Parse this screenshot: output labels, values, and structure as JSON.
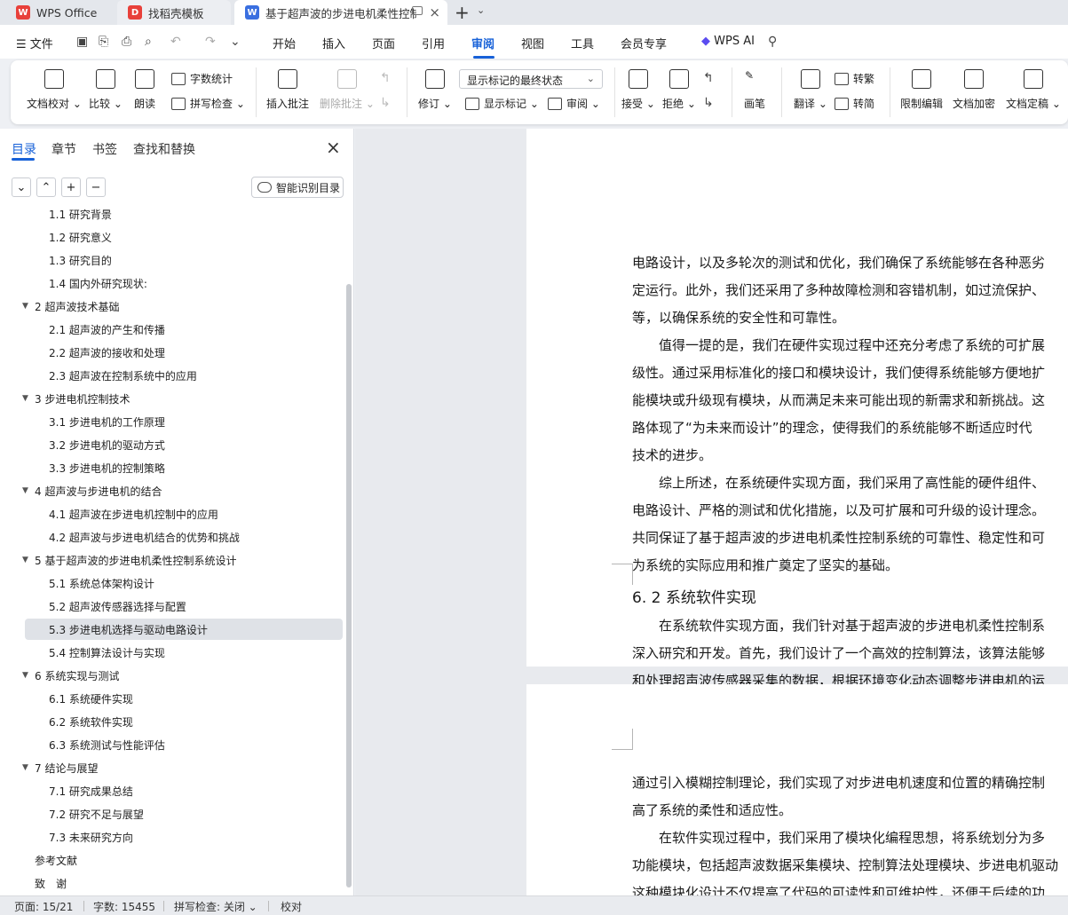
{
  "tabs": {
    "wps_office": "WPS Office",
    "templates": "找稻壳模板",
    "document": "基于超声波的步进电机柔性控制"
  },
  "menubar": {
    "file": "文件",
    "items": [
      "开始",
      "插入",
      "页面",
      "引用",
      "审阅",
      "视图",
      "工具",
      "会员专享"
    ],
    "active": "审阅",
    "wps_ai": "WPS AI"
  },
  "ribbon": {
    "proofread": "文档校对",
    "compare": "比较",
    "read_aloud": "朗读",
    "word_count": "字数统计",
    "spell_check": "拼写检查",
    "insert_comment": "插入批注",
    "delete_comment": "删除批注",
    "track_changes": "修订",
    "markup_mode": "显示标记的最终状态",
    "show_markup": "显示标记",
    "review": "审阅",
    "accept": "接受",
    "reject": "拒绝",
    "pen": "画笔",
    "translate": "翻译",
    "to_traditional": "转繁",
    "to_simplified": "转简",
    "restrict_edit": "限制编辑",
    "encrypt": "文档加密",
    "finalize": "文档定稿"
  },
  "sidebar": {
    "tabs": [
      "目录",
      "章节",
      "书签",
      "查找和替换"
    ],
    "smart_toc": "智能识别目录",
    "toc": [
      {
        "text": "1.1  研究背景",
        "level": 2
      },
      {
        "text": "1.2  研究意义",
        "level": 2
      },
      {
        "text": "1.3  研究目的",
        "level": 2
      },
      {
        "text": "1.4 国内外研究现状:",
        "level": 2
      },
      {
        "text": "2  超声波技术基础",
        "level": 1
      },
      {
        "text": "2.1  超声波的产生和传播",
        "level": 2
      },
      {
        "text": "2.2  超声波的接收和处理",
        "level": 2
      },
      {
        "text": "2.3  超声波在控制系统中的应用",
        "level": 2
      },
      {
        "text": "3  步进电机控制技术",
        "level": 1
      },
      {
        "text": "3.1  步进电机的工作原理",
        "level": 2
      },
      {
        "text": "3.2  步进电机的驱动方式",
        "level": 2
      },
      {
        "text": "3.3  步进电机的控制策略",
        "level": 2
      },
      {
        "text": "4  超声波与步进电机的结合",
        "level": 1
      },
      {
        "text": "4.1  超声波在步进电机控制中的应用",
        "level": 2
      },
      {
        "text": "4.2  超声波与步进电机结合的优势和挑战",
        "level": 2
      },
      {
        "text": "5  基于超声波的步进电机柔性控制系统设计",
        "level": 1
      },
      {
        "text": "5.1  系统总体架构设计",
        "level": 2
      },
      {
        "text": "5.2  超声波传感器选择与配置",
        "level": 2
      },
      {
        "text": "5.3  步进电机选择与驱动电路设计",
        "level": 2,
        "selected": true
      },
      {
        "text": "5.4  控制算法设计与实现",
        "level": 2
      },
      {
        "text": "6  系统实现与测试",
        "level": 1
      },
      {
        "text": "6.1  系统硬件实现",
        "level": 2
      },
      {
        "text": "6.2  系统软件实现",
        "level": 2
      },
      {
        "text": "6.3  系统测试与性能评估",
        "level": 2
      },
      {
        "text": "7  结论与展望",
        "level": 1
      },
      {
        "text": "7.1  研究成果总结",
        "level": 2
      },
      {
        "text": "7.2  研究不足与展望",
        "level": 2
      },
      {
        "text": "7.3  未来研究方向",
        "level": 2
      },
      {
        "text": "参考文献",
        "level": 0
      },
      {
        "text": "致　谢",
        "level": 0
      }
    ]
  },
  "document": {
    "page1_lines": [
      "电路设计，以及多轮次的测试和优化，我们确保了系统能够在各种恶劣",
      "定运行。此外，我们还采用了多种故障检测和容错机制，如过流保护、",
      "等，以确保系统的安全性和可靠性。",
      "　　值得一提的是，我们在硬件实现过程中还充分考虑了系统的可扩展",
      "级性。通过采用标准化的接口和模块设计，我们使得系统能够方便地扩",
      "能模块或升级现有模块，从而满足未来可能出现的新需求和新挑战。这",
      "路体现了“为未来而设计”的理念，使得我们的系统能够不断适应时代",
      "技术的进步。",
      "　　综上所述，在系统硬件实现方面，我们采用了高性能的硬件组件、",
      "电路设计、严格的测试和优化措施，以及可扩展和可升级的设计理念。",
      "共同保证了基于超声波的步进电机柔性控制系统的可靠性、稳定性和可",
      "为系统的实际应用和推广奠定了坚实的基础。"
    ],
    "heading": "6. 2  系统软件实现",
    "page1_after": [
      "　　在系统软件实现方面，我们针对基于超声波的步进电机柔性控制系",
      "深入研究和开发。首先，我们设计了一个高效的控制算法，该算法能够",
      "和处理超声波传感器采集的数据，根据环境变化动态调整步进电机的运"
    ],
    "page2_lines": [
      "通过引入模糊控制理论，我们实现了对步进电机速度和位置的精确控制",
      "高了系统的柔性和适应性。",
      "　　在软件实现过程中，我们采用了模块化编程思想，将系统划分为多",
      "功能模块，包括超声波数据采集模块、控制算法处理模块、步进电机驱动",
      "这种模块化设计不仅提高了代码的可读性和可维护性，还便于后续的功"
    ]
  },
  "statusbar": {
    "page": "页面: 15/21",
    "words": "字数: 15455",
    "spell": "拼写检查: 关闭",
    "proof": "校对"
  },
  "colors": {
    "accent": "#1761d8",
    "wps_red": "#e8403a",
    "doc_blue": "#3a6fe0"
  }
}
